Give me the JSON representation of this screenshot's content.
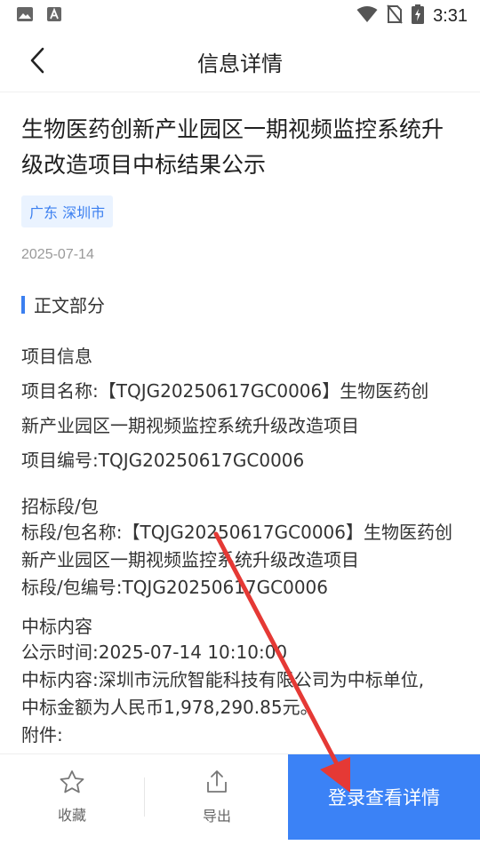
{
  "status_bar": {
    "time": "3:31"
  },
  "nav": {
    "title": "信息详情"
  },
  "article": {
    "title": "生物医药创新产业园区一期视频监控系统升级改造项目中标结果公示",
    "region": "广东 深圳市",
    "date": "2025-07-14",
    "section_title": "正文部分",
    "project_info": {
      "heading": "项目信息",
      "name_line1": "项目名称:【TQJG20250617GC0006】生物医药创",
      "name_line2": "新产业园区一期视频监控系统升级改造项目",
      "code": "项目编号:TQJG20250617GC0006"
    },
    "lot_info": {
      "heading": "招标段/包",
      "name_line1": "标段/包名称:【TQJG20250617GC0006】生物医药创",
      "name_line2": "新产业园区一期视频监控系统升级改造项目",
      "code": "标段/包编号:TQJG20250617GC0006"
    },
    "award_info": {
      "heading": "中标内容",
      "time": "公示时间:2025-07-14 10:10:00",
      "content_line1": "中标内容:深圳市沅欣智能科技有限公司为中标单位,",
      "content_line2": "中标金额为人民币1,978,290.85元。",
      "attachment": "附件:"
    }
  },
  "bottom": {
    "favorite_label": "收藏",
    "export_label": "导出",
    "login_label": "登录查看详情"
  },
  "colors": {
    "accent": "#3b82f6",
    "tag_bg": "#eaf3ff",
    "annotation": "#e53935"
  }
}
